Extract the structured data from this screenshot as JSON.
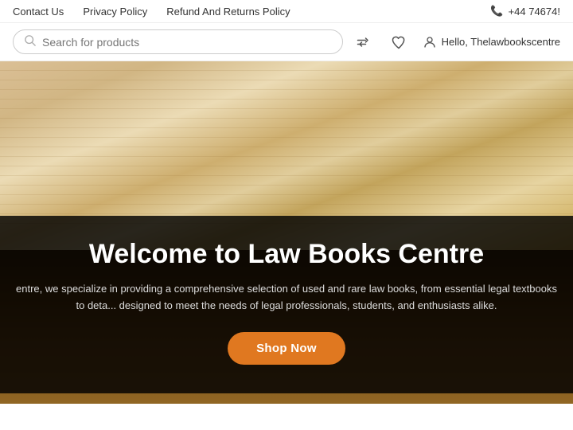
{
  "topbar": {
    "link1": "Contact Us",
    "link2": "Privacy Policy",
    "link3": "Refund And Returns Policy",
    "phone": "+44 74674!"
  },
  "search": {
    "placeholder": "Search for products"
  },
  "user": {
    "greeting": "Hello, Thelawbookscentre"
  },
  "hero": {
    "title": "Welcome to Law Books Centre",
    "description": "entre, we specialize in providing a comprehensive selection of used and rare law books, from essential legal textbooks to deta... designed to meet the needs of legal professionals, students, and enthusiasts alike.",
    "cta_label": "Shop Now"
  },
  "icons": {
    "search": "🔍",
    "shuffle": "⇄",
    "heart": "♡",
    "user": "👤",
    "phone": "📞"
  }
}
